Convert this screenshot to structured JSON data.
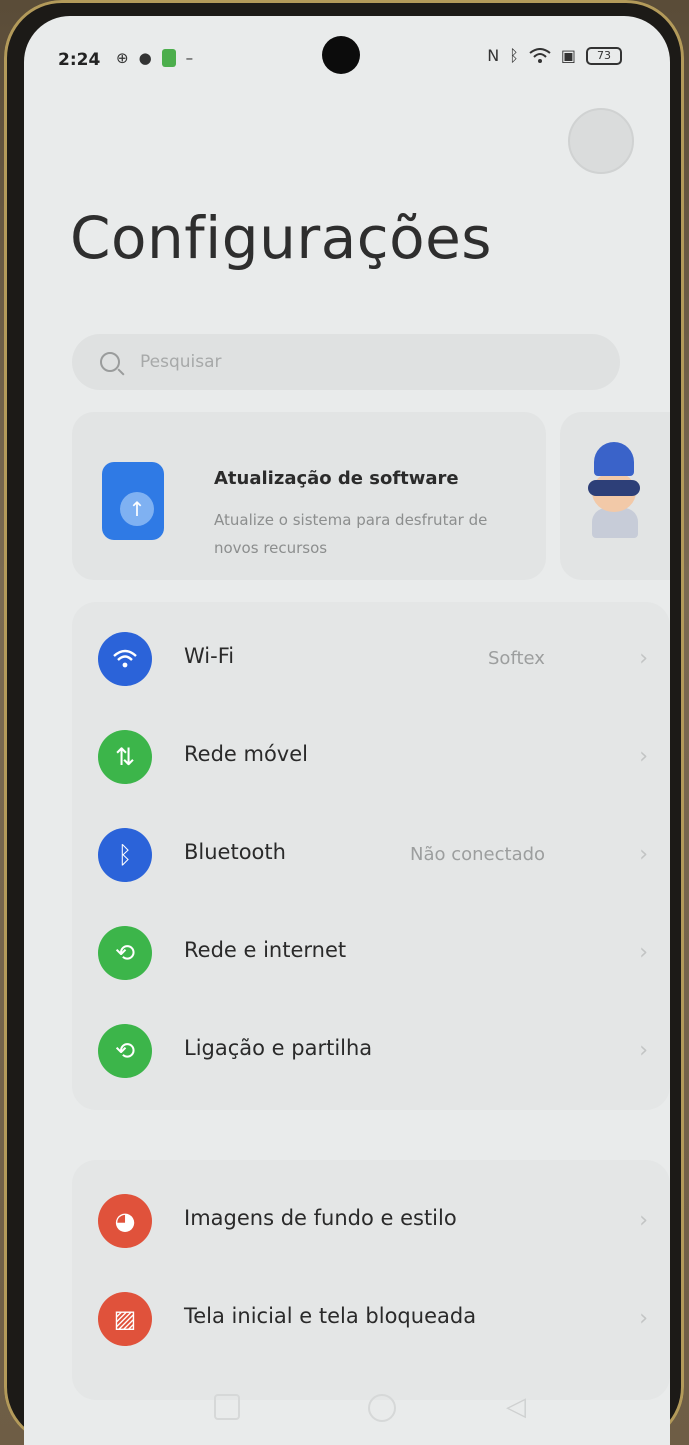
{
  "status_bar": {
    "time": "2:24",
    "battery": "73",
    "icons_left": [
      "vpn-icon",
      "notification-icon",
      "app-icon",
      "minus-icon"
    ],
    "icons_right": [
      "nfc-icon",
      "bluetooth-icon",
      "wifi-icon",
      "no-sim-icon",
      "battery-icon"
    ]
  },
  "header": {
    "title": "Configurações",
    "search_placeholder": "Pesquisar"
  },
  "banner": {
    "title": "Atualização de software",
    "description": "Atualize o sistema para desfrutar de novos recursos"
  },
  "settings_group_1": [
    {
      "label": "Wi-Fi",
      "value": "Softex",
      "icon": "wifi-icon",
      "color": "#2b63d9"
    },
    {
      "label": "Rede móvel",
      "value": "",
      "icon": "mobile-data-icon",
      "color": "#3cb54a"
    },
    {
      "label": "Bluetooth",
      "value": "Não conectado",
      "icon": "bluetooth-icon",
      "color": "#2b63d9"
    },
    {
      "label": "Rede e internet",
      "value": "",
      "icon": "network-icon",
      "color": "#3cb54a"
    },
    {
      "label": "Ligação e partilha",
      "value": "",
      "icon": "share-icon",
      "color": "#3cb54a"
    }
  ],
  "settings_group_2": [
    {
      "label": "Imagens de fundo e estilo",
      "value": "",
      "icon": "palette-icon",
      "color": "#e0523b"
    },
    {
      "label": "Tela inicial e tela bloqueada",
      "value": "",
      "icon": "image-icon",
      "color": "#e0523b"
    }
  ],
  "nav": [
    "recent-apps",
    "home",
    "back"
  ]
}
